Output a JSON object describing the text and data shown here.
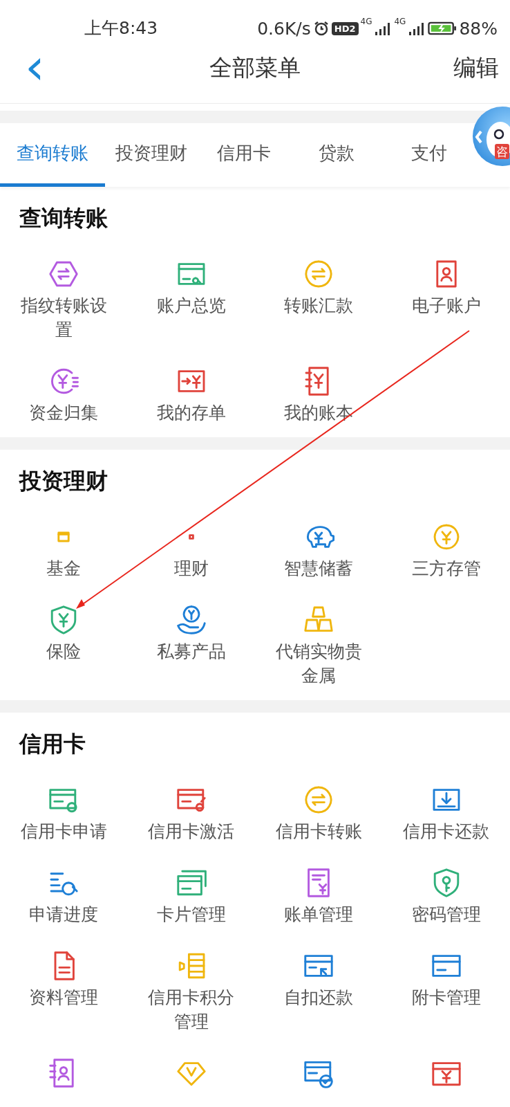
{
  "status_bar": {
    "time": "上午8:43",
    "speed": "0.6K/s",
    "hd_badge": "HD2",
    "network_1": "4G",
    "network_2": "4G",
    "battery": "88%"
  },
  "nav": {
    "back": "‹",
    "title": "全部菜单",
    "action": "编辑"
  },
  "tabs": [
    {
      "label": "查询转账",
      "selected": true
    },
    {
      "label": "投资理财",
      "selected": false
    },
    {
      "label": "信用卡",
      "selected": false
    },
    {
      "label": "贷款",
      "selected": false
    },
    {
      "label": "支付",
      "selected": false
    }
  ],
  "assistant": {
    "badge": "咨"
  },
  "sections": [
    {
      "title": "查询转账",
      "items": [
        {
          "kind": "labeled",
          "label": "指纹转账设置"
        },
        {
          "kind": "labeled",
          "label": "账户总览"
        },
        {
          "kind": "labeled",
          "label": "转账汇款"
        },
        {
          "kind": "labeled",
          "label": "电子账户"
        },
        {
          "kind": "labeled",
          "label": "资金归集"
        },
        {
          "kind": "labeled",
          "label": "我的存单"
        },
        {
          "kind": "labeled",
          "label": "我的账本"
        }
      ]
    },
    {
      "title": "投资理财",
      "items": [
        {
          "kind": "labeled",
          "label": "基金"
        },
        {
          "kind": "labeled",
          "label": "理财"
        },
        {
          "kind": "labeled",
          "label": "智慧储蓄"
        },
        {
          "kind": "labeled",
          "label": "三方存管"
        },
        {
          "kind": "labeled",
          "label": "保险"
        },
        {
          "kind": "labeled",
          "label": "私募产品"
        },
        {
          "kind": "labeled",
          "label": "代销实物贵金属"
        }
      ]
    },
    {
      "title": "信用卡",
      "items": [
        {
          "kind": "labeled",
          "label": "信用卡申请"
        },
        {
          "kind": "labeled",
          "label": "信用卡激活"
        },
        {
          "kind": "labeled",
          "label": "信用卡转账"
        },
        {
          "kind": "labeled",
          "label": "信用卡还款"
        },
        {
          "kind": "labeled",
          "label": "申请进度"
        },
        {
          "kind": "labeled",
          "label": "卡片管理"
        },
        {
          "kind": "labeled",
          "label": "账单管理"
        },
        {
          "kind": "labeled",
          "label": "密码管理"
        },
        {
          "kind": "labeled",
          "label": "资料管理"
        },
        {
          "kind": "labeled",
          "label": "信用卡积分管理"
        },
        {
          "kind": "labeled",
          "label": "自扣还款"
        },
        {
          "kind": "labeled",
          "label": "附卡管理"
        },
        {
          "kind": "cut"
        },
        {
          "kind": "cut"
        },
        {
          "kind": "cut"
        },
        {
          "kind": "cut"
        }
      ]
    }
  ]
}
